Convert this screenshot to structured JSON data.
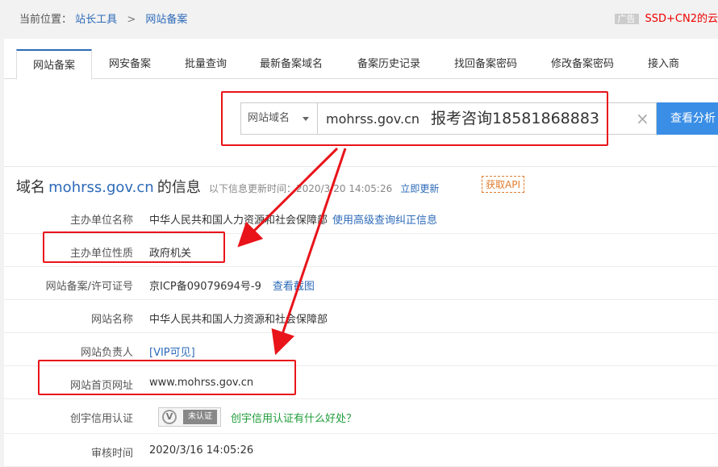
{
  "breadcrumb": {
    "prefix": "当前位置：",
    "item1": "站长工具",
    "sep": ">",
    "item2": "网站备案"
  },
  "ad": {
    "tag": "广告",
    "text": "SSD+CN2的云"
  },
  "tabs": [
    {
      "label": "网站备案"
    },
    {
      "label": "网安备案"
    },
    {
      "label": "批量查询"
    },
    {
      "label": "最新备案域名"
    },
    {
      "label": "备案历史记录"
    },
    {
      "label": "找回备案密码"
    },
    {
      "label": "修改备案密码"
    },
    {
      "label": "接入商"
    }
  ],
  "search": {
    "select_value": "网站域名",
    "input_value": "mohrss.gov.cn",
    "extra_text": "报考咨询18581868883",
    "button_label": "查看分析"
  },
  "info": {
    "title_prefix": "域名",
    "domain": "mohrss.gov.cn",
    "title_suffix": "的信息",
    "update_time": "以下信息更新时间：2020/3/20 14:05:26",
    "refresh_label": "立即更新",
    "api_label": "获取API"
  },
  "rows": [
    {
      "label": "主办单位名称",
      "value": "中华人民共和国人力资源和社会保障部",
      "link": "使用高级查询纠正信息"
    },
    {
      "label": "主办单位性质",
      "value": "政府机关"
    },
    {
      "label": "网站备案/许可证号",
      "value": "京ICP备09079694号-9",
      "link": "查看截图"
    },
    {
      "label": "网站名称",
      "value": "中华人民共和国人力资源和社会保障部"
    },
    {
      "label": "网站负责人",
      "value": "[VIP可见]"
    },
    {
      "label": "网站首页网址",
      "value": "www.mohrss.gov.cn"
    },
    {
      "label": "创宇信用认证",
      "badge": "未认证",
      "badge_letter": "V",
      "link": "创宇信用认证有什么好处？"
    },
    {
      "label": "审核时间",
      "value": "2020/3/16 14:05:26"
    }
  ],
  "colors": {
    "accent": "#2d6ab8",
    "button": "#3a8ee6",
    "highlight": "#e8141a",
    "api": "#e07b2e"
  }
}
